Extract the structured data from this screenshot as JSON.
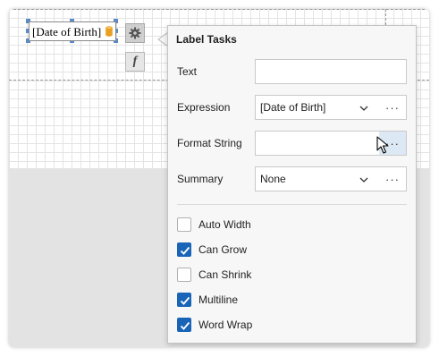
{
  "designer": {
    "label_text": "[Date of Birth]",
    "db_icon": "database-icon",
    "smart_tag_icon": "gear-icon",
    "expression_button_label": "f"
  },
  "popup": {
    "title": "Label Tasks",
    "rows": {
      "text": {
        "label": "Text",
        "value": ""
      },
      "expression": {
        "label": "Expression",
        "value": "[Date of Birth]",
        "ellipsis": "···"
      },
      "format_string": {
        "label": "Format String",
        "value": "",
        "ellipsis": "···"
      },
      "summary": {
        "label": "Summary",
        "value": "None",
        "ellipsis": "···"
      }
    },
    "checkboxes": [
      {
        "label": "Auto Width",
        "checked": false
      },
      {
        "label": "Can Grow",
        "checked": true
      },
      {
        "label": "Can Shrink",
        "checked": false
      },
      {
        "label": "Multiline",
        "checked": true
      },
      {
        "label": "Word Wrap",
        "checked": true
      }
    ]
  },
  "colors": {
    "accent": "#1a64b8",
    "db_icon": "#e8a020",
    "selection_handle": "#5b8ac7"
  }
}
